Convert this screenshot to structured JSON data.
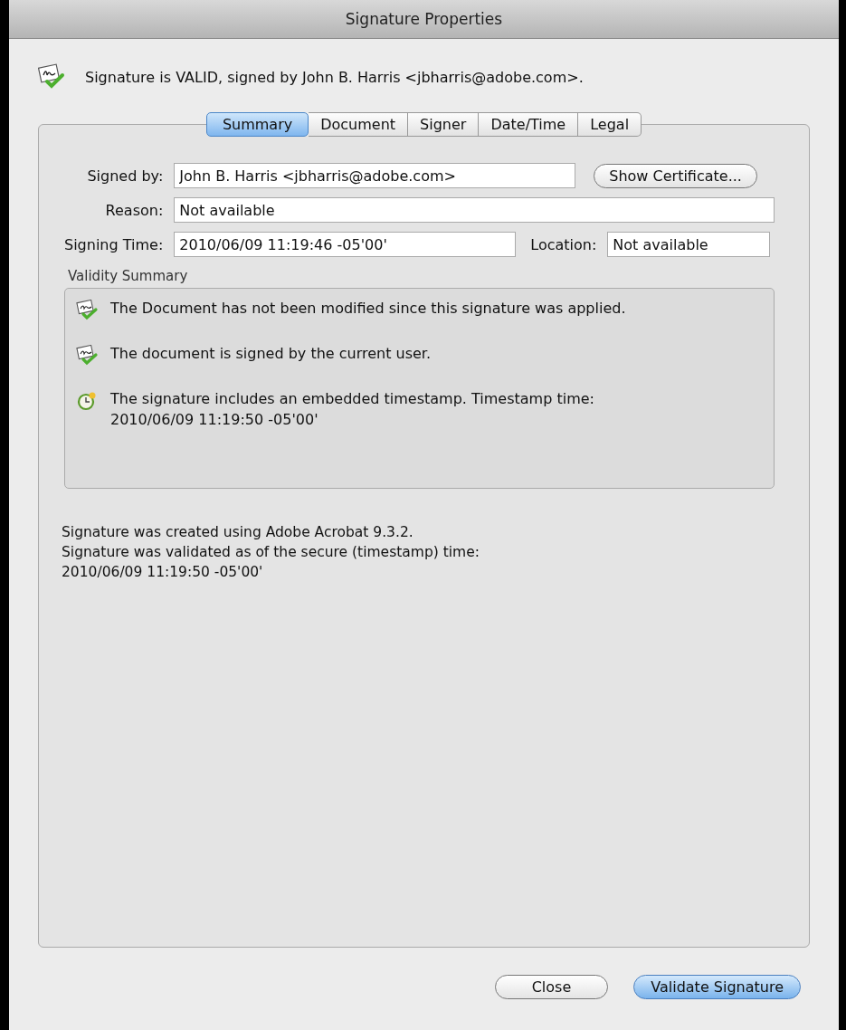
{
  "window": {
    "title": "Signature Properties"
  },
  "status": {
    "message": "Signature is VALID, signed by John B. Harris <jbharris@adobe.com>."
  },
  "tabs": [
    {
      "label": "Summary",
      "selected": true
    },
    {
      "label": "Document",
      "selected": false
    },
    {
      "label": "Signer",
      "selected": false
    },
    {
      "label": "Date/Time",
      "selected": false
    },
    {
      "label": "Legal",
      "selected": false
    }
  ],
  "fields": {
    "signed_by": {
      "label": "Signed by:",
      "value": "John B. Harris <jbharris@adobe.com>"
    },
    "show_certificate_button": "Show Certificate...",
    "reason": {
      "label": "Reason:",
      "value": "Not available"
    },
    "signing_time": {
      "label": "Signing Time:",
      "value": "2010/06/09 11:19:46 -05'00'"
    },
    "location": {
      "label": "Location:",
      "value": "Not available"
    }
  },
  "validity_summary": {
    "title": "Validity Summary",
    "items": [
      {
        "kind": "check",
        "lines": [
          "The Document has not been modified since this signature was applied."
        ]
      },
      {
        "kind": "check",
        "lines": [
          "The document is signed by the current user."
        ]
      },
      {
        "kind": "timestamp",
        "lines": [
          "The signature includes an embedded timestamp. Timestamp time:",
          "2010/06/09 11:19:50 -05'00'"
        ]
      }
    ]
  },
  "notes": [
    "Signature was created using Adobe Acrobat 9.3.2.",
    "Signature was validated as of the secure (timestamp) time:",
    "2010/06/09 11:19:50 -05'00'"
  ],
  "buttons": [
    {
      "label": "Close",
      "default": false
    },
    {
      "label": "Validate Signature",
      "default": true
    }
  ]
}
